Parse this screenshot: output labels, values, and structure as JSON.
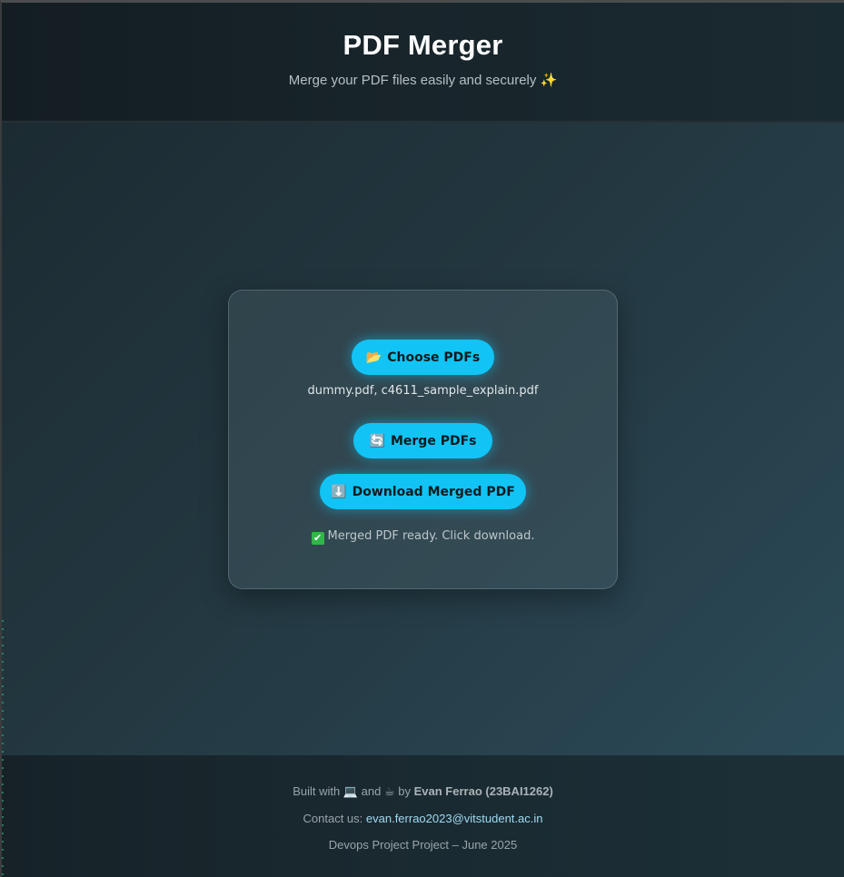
{
  "header": {
    "title": "PDF Merger",
    "subtitle": "Merge your PDF files easily and securely ✨"
  },
  "card": {
    "choose_icon": "📂",
    "choose_label": "Choose PDFs",
    "files_text": "dummy.pdf, c4611_sample_explain.pdf",
    "merge_icon": "🔄",
    "merge_label": "Merge PDFs",
    "download_icon": "⬇️",
    "download_label": "Download Merged PDF",
    "status_icon": "✔",
    "status_text": "Merged PDF ready. Click download."
  },
  "footer": {
    "built_prefix": "Built with",
    "laptop_emoji": "💻",
    "and_text": "and",
    "coffee_emoji": "☕",
    "by_text": "by",
    "author": "Evan Ferrao (23BAI1262)",
    "contact_label": "Contact us:",
    "contact_email": "evan.ferrao2023@vitstudent.ac.in",
    "project_line": "Devops Project Project – June 2025"
  },
  "colors": {
    "accent": "#11c4f5",
    "header_bg": "#131d22",
    "card_border": "#8ca5af"
  }
}
